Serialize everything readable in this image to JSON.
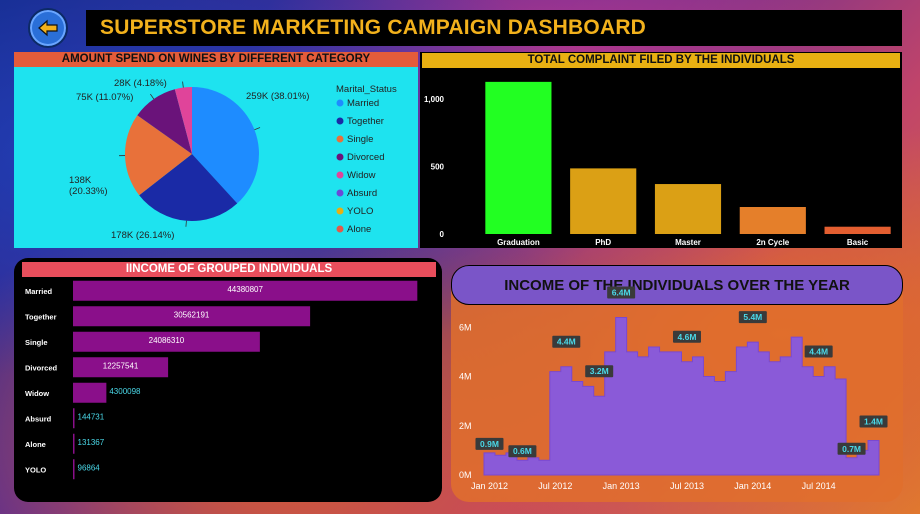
{
  "header": {
    "title": "SUPERSTORE MARKETING CAMPAIGN DASHBOARD",
    "back_icon": "arrow-left-icon"
  },
  "colors": {
    "accent_title": "#f2b11c",
    "back_button": "#2a6fd8"
  },
  "chart_data": [
    {
      "type": "pie",
      "title": "AMOUNT SPEND ON WINES BY DIFFERENT CATEGORY",
      "legend_title": "Marital_Status",
      "legend_position": "right",
      "slices": [
        {
          "name": "Married",
          "value": 259,
          "label": "259K (38.01%)",
          "color": "#1e8cff"
        },
        {
          "name": "Together",
          "value": 178,
          "label": "178K (26.14%)",
          "color": "#1a2aa6"
        },
        {
          "name": "Single",
          "value": 138,
          "label": "138K\n(20.33%)",
          "color": "#e8713a"
        },
        {
          "name": "Divorced",
          "value": 75,
          "label": "75K (11.07%)",
          "color": "#6a137a"
        },
        {
          "name": "Widow",
          "value": 28,
          "label": "28K (4.18%)",
          "color": "#e0449a"
        }
      ],
      "legend": [
        {
          "name": "Married",
          "color": "#1e8cff"
        },
        {
          "name": "Together",
          "color": "#1a2aa6"
        },
        {
          "name": "Single",
          "color": "#e8713a"
        },
        {
          "name": "Divorced",
          "color": "#6a137a"
        },
        {
          "name": "Widow",
          "color": "#e0449a"
        },
        {
          "name": "Absurd",
          "color": "#6a4ad8"
        },
        {
          "name": "YOLO",
          "color": "#e8b012"
        },
        {
          "name": "Alone",
          "color": "#e25a4a"
        }
      ]
    },
    {
      "type": "bar",
      "title": "TOTAL COMPLAINT FILED BY THE INDIVIDUALS",
      "categories": [
        "Graduation",
        "PhD",
        "Master",
        "2n Cycle",
        "Basic"
      ],
      "values": [
        1127,
        486,
        370,
        200,
        54
      ],
      "colors": [
        "#22ff22",
        "#dba015",
        "#dba015",
        "#e57f2a",
        "#e35e30"
      ],
      "yticks": [
        {
          "v": 0,
          "label": "0"
        },
        {
          "v": 500,
          "label": "500"
        },
        {
          "v": 1000,
          "label": "1,000"
        }
      ],
      "ylim": [
        0,
        1200
      ]
    },
    {
      "type": "bar",
      "orientation": "horizontal",
      "title": "IINCOME OF GROUPED INDIVIDUALS",
      "categories": [
        "Married",
        "Together",
        "Single",
        "Divorced",
        "Widow",
        "Absurd",
        "Alone",
        "YOLO"
      ],
      "values": [
        44380807,
        30562191,
        24086310,
        12257541,
        4300098,
        144731,
        131367,
        96864
      ],
      "value_labels": [
        "44380807",
        "30562191",
        "24086310",
        "12257541",
        "4300098",
        "144731",
        "131367",
        "96864"
      ],
      "bar_color": "#8a0f8a",
      "xlim": [
        0,
        45500000
      ]
    },
    {
      "type": "area",
      "title": "INCOME OF THE INDIVIDUALS OVER THE YEAR",
      "x": [
        "2012-01",
        "2012-02",
        "2012-03",
        "2012-04",
        "2012-05",
        "2012-06",
        "2012-07",
        "2012-08",
        "2012-09",
        "2012-10",
        "2012-11",
        "2012-12",
        "2013-01",
        "2013-02",
        "2013-03",
        "2013-04",
        "2013-05",
        "2013-06",
        "2013-07",
        "2013-08",
        "2013-09",
        "2013-10",
        "2013-11",
        "2013-12",
        "2014-01",
        "2014-02",
        "2014-03",
        "2014-04",
        "2014-05",
        "2014-06",
        "2014-07",
        "2014-08",
        "2014-09",
        "2014-10",
        "2014-11",
        "2014-12"
      ],
      "values": [
        0.9,
        0.8,
        0.9,
        0.6,
        0.7,
        0.6,
        4.2,
        4.4,
        3.8,
        3.6,
        3.2,
        5.0,
        6.4,
        5.0,
        4.8,
        5.2,
        5.0,
        5.0,
        4.6,
        4.8,
        4.0,
        3.8,
        4.2,
        5.2,
        5.4,
        5.0,
        4.6,
        4.8,
        5.6,
        4.4,
        4.0,
        4.4,
        3.9,
        0.7,
        1.0,
        1.4
      ],
      "point_labels": [
        {
          "i": 0,
          "label": "0.9M"
        },
        {
          "i": 3,
          "label": "0.6M"
        },
        {
          "i": 7,
          "label": "4.4M"
        },
        {
          "i": 10,
          "label": "3.2M"
        },
        {
          "i": 12,
          "label": "6.4M"
        },
        {
          "i": 18,
          "label": "4.6M"
        },
        {
          "i": 24,
          "label": "5.4M"
        },
        {
          "i": 30,
          "label": "4.4M"
        },
        {
          "i": 33,
          "label": "0.7M"
        },
        {
          "i": 35,
          "label": "1.4M"
        }
      ],
      "xtick_labels": [
        {
          "i": 0,
          "label": "Jan 2012"
        },
        {
          "i": 6,
          "label": "Jul 2012"
        },
        {
          "i": 12,
          "label": "Jan 2013"
        },
        {
          "i": 18,
          "label": "Jul 2013"
        },
        {
          "i": 24,
          "label": "Jan 2014"
        },
        {
          "i": 30,
          "label": "Jul 2014"
        }
      ],
      "yticks": [
        {
          "v": 0,
          "label": "0M"
        },
        {
          "v": 2,
          "label": "2M"
        },
        {
          "v": 4,
          "label": "4M"
        },
        {
          "v": 6,
          "label": "6M"
        }
      ],
      "ylim": [
        0,
        6.5
      ],
      "fill_color": "#8a5ad8"
    }
  ]
}
